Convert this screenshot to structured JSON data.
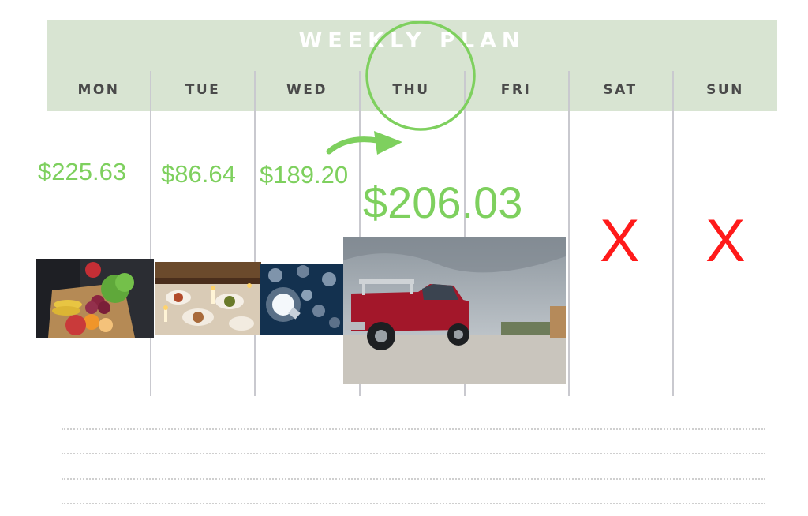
{
  "header": {
    "title": "WEEKLY PLAN"
  },
  "days": [
    "MON",
    "TUE",
    "WED",
    "THU",
    "FRI",
    "SAT",
    "SUN"
  ],
  "amounts": {
    "mon": "$225.63",
    "tue": "$86.64",
    "wed": "$189.20",
    "thu": "$206.03"
  },
  "weekend_marks": {
    "sat": "X",
    "sun": "X"
  },
  "photos": [
    {
      "name": "groceries-photo",
      "subject": "grocery bag with fruit and vegetables"
    },
    {
      "name": "dinner-table-photo",
      "subject": "festive dinner table with candles"
    },
    {
      "name": "light-bulb-photo",
      "subject": "glowing light bulbs on blue background"
    },
    {
      "name": "red-truck-photo",
      "subject": "red pickup truck on gravel under cloudy sky"
    }
  ],
  "colors": {
    "header_band": "#d8e4d2",
    "amount_green": "#7ed05e",
    "x_red": "#ff1a1a",
    "highlight_circle": "#7ed05e",
    "divider": "#c9c9cf"
  }
}
